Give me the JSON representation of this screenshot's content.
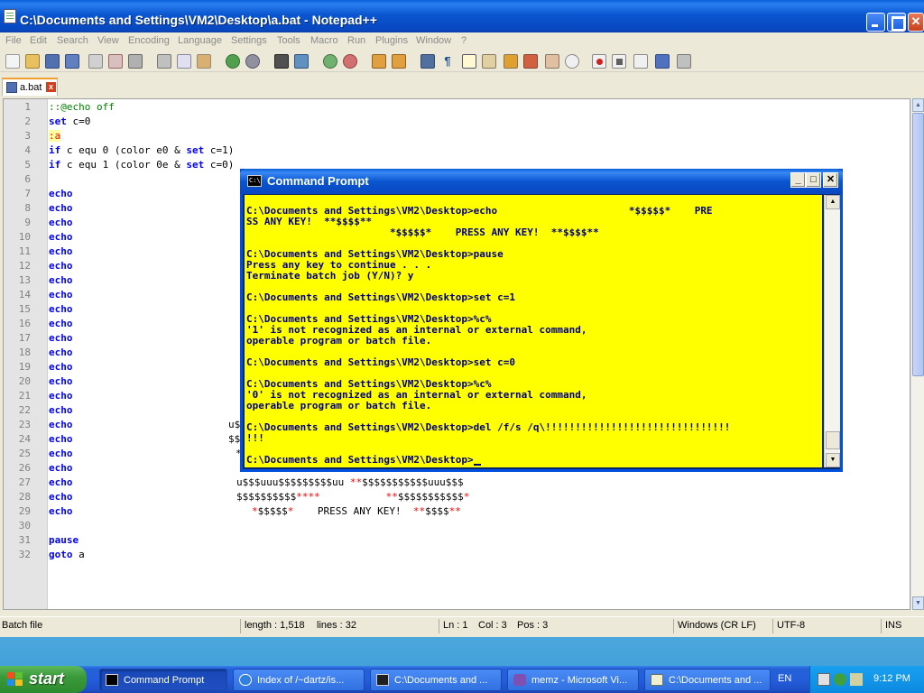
{
  "notepad": {
    "title": "C:\\Documents and Settings\\VM2\\Desktop\\a.bat - Notepad++",
    "menu": [
      "File",
      "Edit",
      "Search",
      "View",
      "Encoding",
      "Language",
      "Settings",
      "Tools",
      "Macro",
      "Run",
      "Plugins",
      "Window",
      "?"
    ],
    "tab_label": "a.bat",
    "close_x": "x",
    "line_numbers": [
      "1",
      "2",
      "3",
      "4",
      "5",
      "6",
      "7",
      "8",
      "9",
      "10",
      "11",
      "12",
      "13",
      "14",
      "15",
      "16",
      "17",
      "18",
      "19",
      "20",
      "21",
      "22",
      "23",
      "24",
      "25",
      "26",
      "27",
      "28",
      "29",
      "30",
      "31",
      "32"
    ],
    "code": {
      "l1": "::@echo off",
      "l2_kw": "set",
      "l2_rest": " c=0",
      "l3": ":a",
      "l4_kw": "if",
      "l4_rest": " c equ 0 (color e0 & ",
      "l4_kw2": "set",
      "l4_rest2": " c=1)",
      "l5_kw": "if",
      "l5_rest": " c equ 1 (color 0e & ",
      "l5_kw2": "set",
      "l5_rest2": " c=0)",
      "echo": "echo",
      "pause": "pause",
      "goto": "goto",
      "goto_rest": " a",
      "ascii_23": "u$",
      "ascii_24": "$$",
      "ascii_25": "*",
      "ascii_27a": "u$$$uuu$$$$$$$$$uu ",
      "ascii_27b": "**",
      "ascii_27c": "$$$$$$$$$$$uuu$$$",
      "ascii_28a": "$$$$$$$$$$",
      "ascii_28b": "****",
      "ascii_28c": "           ",
      "ascii_28d": "**",
      "ascii_28e": "$$$$$$$$$$$",
      "ascii_28f": "*",
      "ascii_29a": "*",
      "ascii_29b": "$$$$$",
      "ascii_29c": "*",
      "ascii_29d": "    PRESS ANY KEY!  ",
      "ascii_29e": "**",
      "ascii_29f": "$$$$",
      "ascii_29g": "**"
    },
    "status": {
      "type": "Batch file",
      "length": "length : 1,518",
      "lines": "lines : 32",
      "ln": "Ln : 1",
      "col": "Col : 3",
      "pos": "Pos : 3",
      "eol": "Windows (CR LF)",
      "encoding": "UTF-8",
      "ins": "INS"
    }
  },
  "cmd": {
    "title": "Command Prompt",
    "icon_text": "C:\\",
    "lines": [
      "C:\\Documents and Settings\\VM2\\Desktop>echo                      *$$$$$*    PRE",
      "SS ANY KEY!  **$$$$**",
      "                        *$$$$$*    PRESS ANY KEY!  **$$$$**",
      "",
      "C:\\Documents and Settings\\VM2\\Desktop>pause",
      "Press any key to continue . . .",
      "Terminate batch job (Y/N)? y",
      "",
      "C:\\Documents and Settings\\VM2\\Desktop>set c=1",
      "",
      "C:\\Documents and Settings\\VM2\\Desktop>%c%",
      "'1' is not recognized as an internal or external command,",
      "operable program or batch file.",
      "",
      "C:\\Documents and Settings\\VM2\\Desktop>set c=0",
      "",
      "C:\\Documents and Settings\\VM2\\Desktop>%c%",
      "'0' is not recognized as an internal or external command,",
      "operable program or batch file.",
      "",
      "C:\\Documents and Settings\\VM2\\Desktop>del /f/s /q\\!!!!!!!!!!!!!!!!!!!!!!!!!!!!!!!",
      "!!!",
      "",
      "C:\\Documents and Settings\\VM2\\Desktop>"
    ]
  },
  "taskbar": {
    "start": "start",
    "tasks": [
      "Command Prompt",
      "Index of /~dartz/is...",
      "C:\\Documents and ...",
      "memz - Microsoft Vi...",
      "C:\\Documents and ..."
    ],
    "lang": "EN",
    "clock": "9:12 PM"
  },
  "colors": {
    "cmd_background": "#ffff00",
    "cmd_text": "#000080",
    "keyword": "#0000ff",
    "comment": "#008000",
    "label": "#ff0000"
  }
}
